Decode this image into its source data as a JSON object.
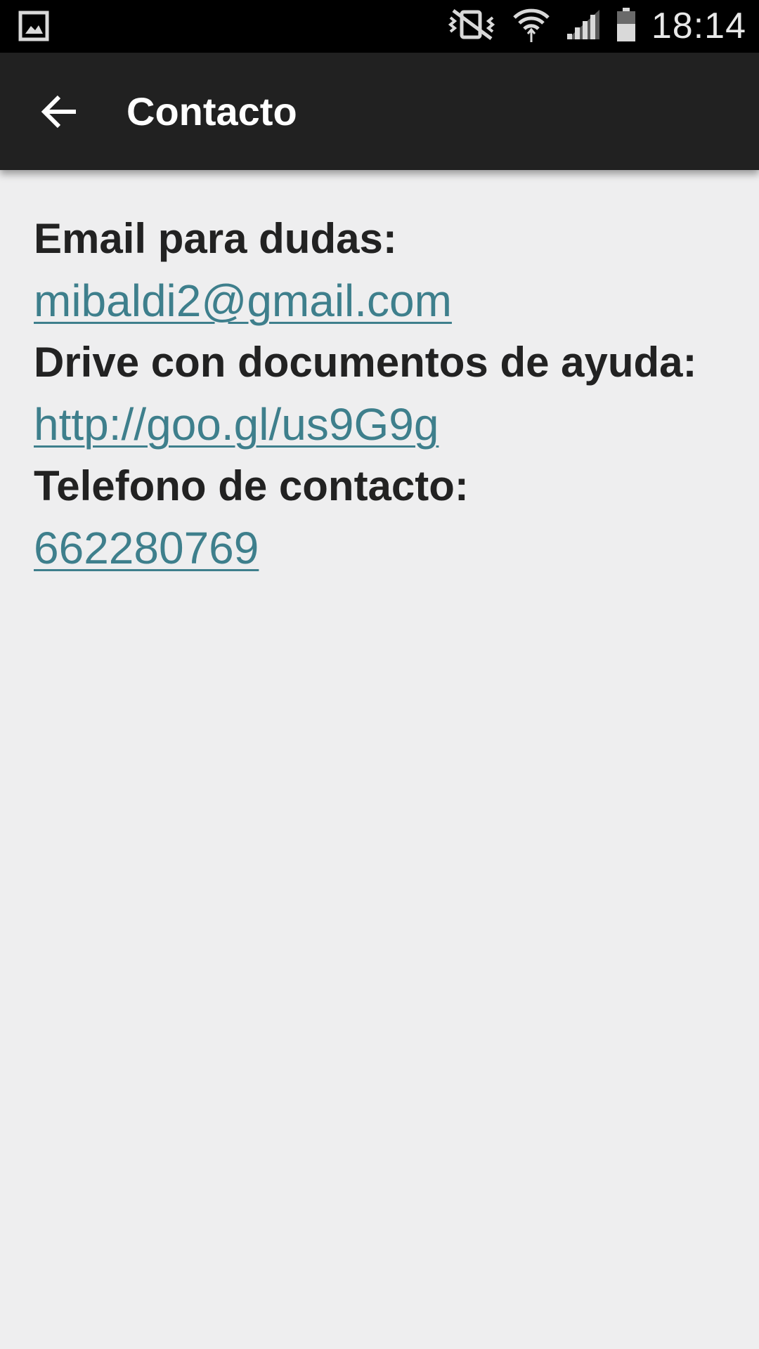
{
  "status_bar": {
    "time": "18:14",
    "icons": [
      "gallery-notification-icon",
      "vibrate-mute-icon",
      "wifi-icon",
      "signal-icon",
      "battery-icon"
    ]
  },
  "app_bar": {
    "title": "Contacto",
    "back_icon": "arrow-back-icon",
    "background": "#212121"
  },
  "contact": {
    "email_label": "Email para dudas:",
    "email_value": "mibaldi2@gmail.com",
    "drive_label": "Drive con documentos de ayuda:",
    "drive_value": "http://goo.gl/us9G9g",
    "phone_label": "Telefono de contacto:",
    "phone_value": "662280769"
  },
  "colors": {
    "link": "#3e7f8c",
    "label": "#222222",
    "background": "#eeeeef"
  }
}
